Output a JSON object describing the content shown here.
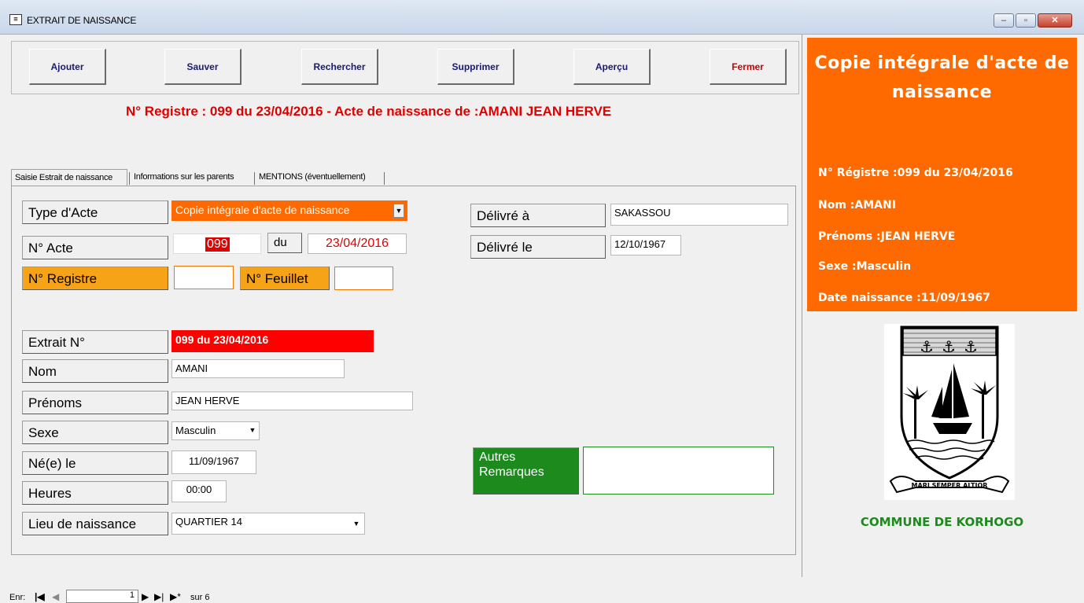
{
  "window": {
    "title": "EXTRAIT DE NAISSANCE",
    "icon": "form-icon"
  },
  "toolbar": {
    "ajouter": "Ajouter",
    "sauver": "Sauver",
    "rechercher": "Rechercher",
    "supprimer": "Supprimer",
    "apercu": "Aperçu",
    "fermer": "Fermer"
  },
  "heading": "N° Registre  :  099 du 23/04/2016 - Acte de naissance de :AMANI  JEAN HERVE",
  "tabs": [
    {
      "label": "Saisie Estrait de naissance",
      "active": true
    },
    {
      "label": "Informations sur les parents",
      "active": false
    },
    {
      "label": "MENTIONS (éventuellement)",
      "active": false
    }
  ],
  "form": {
    "type_acte": {
      "label": "Type d'Acte",
      "value": "Copie intégrale d'acte de naissance"
    },
    "num_acte": {
      "label": "N° Acte",
      "value": "099",
      "du_label": "du",
      "date": "23/04/2016"
    },
    "num_registre": {
      "label": "N° Registre",
      "value": ""
    },
    "num_feuillet": {
      "label": "N° Feuillet",
      "value": ""
    },
    "extrait": {
      "label": "Extrait N°",
      "value": "099 du 23/04/2016"
    },
    "nom": {
      "label": "Nom",
      "value": "AMANI"
    },
    "prenoms": {
      "label": "Prénoms",
      "value": "JEAN HERVE"
    },
    "sexe": {
      "label": "Sexe",
      "value": "Masculin"
    },
    "ne_le": {
      "label": "Né(e) le",
      "value": "11/09/1967"
    },
    "heures": {
      "label": "Heures",
      "value": "00:00"
    },
    "lieu": {
      "label": "Lieu de naissance",
      "value": "QUARTIER 14"
    },
    "delivre_a": {
      "label": "Délivré à",
      "value": "SAKASSOU"
    },
    "delivre_le": {
      "label": "Délivré le",
      "value": "12/10/1967"
    },
    "remarques": {
      "label_line1": "Autres",
      "label_line2": "Remarques",
      "value": ""
    }
  },
  "statusbar": {
    "label": "Enr:",
    "record": "1",
    "total": "sur 6",
    "first_icon": "first-record-icon",
    "prev_icon": "prev-record-icon",
    "next_icon": "next-record-icon",
    "last_icon": "last-record-icon",
    "new_icon": "new-record-icon"
  },
  "summary": {
    "title_line1": "Copie intégrale d'acte de",
    "title_line2": "naissance",
    "registre": "N° Régistre :099 du 23/04/2016",
    "nom": "Nom :AMANI",
    "prenoms": "Prénoms :JEAN HERVE",
    "sexe": "Sexe :Masculin",
    "date_naissance": "Date naissance :11/09/1967"
  },
  "logo": {
    "motto": "MARI SEMPER ALTIOR"
  },
  "commune": "COMMUNE DE KORHOGO",
  "colors": {
    "accent_orange": "#ff6a00",
    "label_orange": "#f7a318",
    "red": "#e00000",
    "green": "#1c8a1c"
  }
}
